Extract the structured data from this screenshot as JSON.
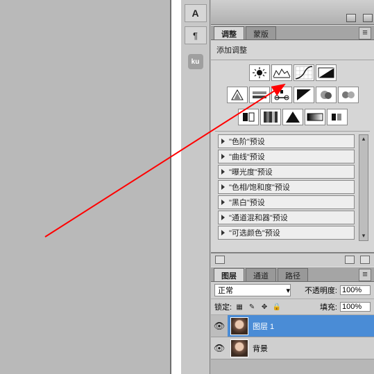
{
  "tabs_adjust": {
    "a": "调整",
    "b": "蒙版"
  },
  "adjust_title": "添加调整",
  "toolbar": {
    "a_tool": "A",
    "pilcrow": "¶",
    "ku": "ku"
  },
  "presets": [
    "\"色阶\"预设",
    "\"曲线\"预设",
    "\"曝光度\"预设",
    "\"色相/饱和度\"预设",
    "\"黑白\"预设",
    "\"通道混和器\"预设",
    "\"可选颜色\"预设"
  ],
  "layers": {
    "tabs": {
      "a": "图层",
      "b": "通道",
      "c": "路径"
    },
    "blend_mode": "正常",
    "opacity_label": "不透明度:",
    "opacity_value": "100%",
    "lock_label": "锁定:",
    "fill_label": "填充:",
    "fill_value": "100%",
    "items": [
      {
        "name": "图层 1",
        "active": true
      },
      {
        "name": "背景",
        "active": false
      }
    ]
  }
}
